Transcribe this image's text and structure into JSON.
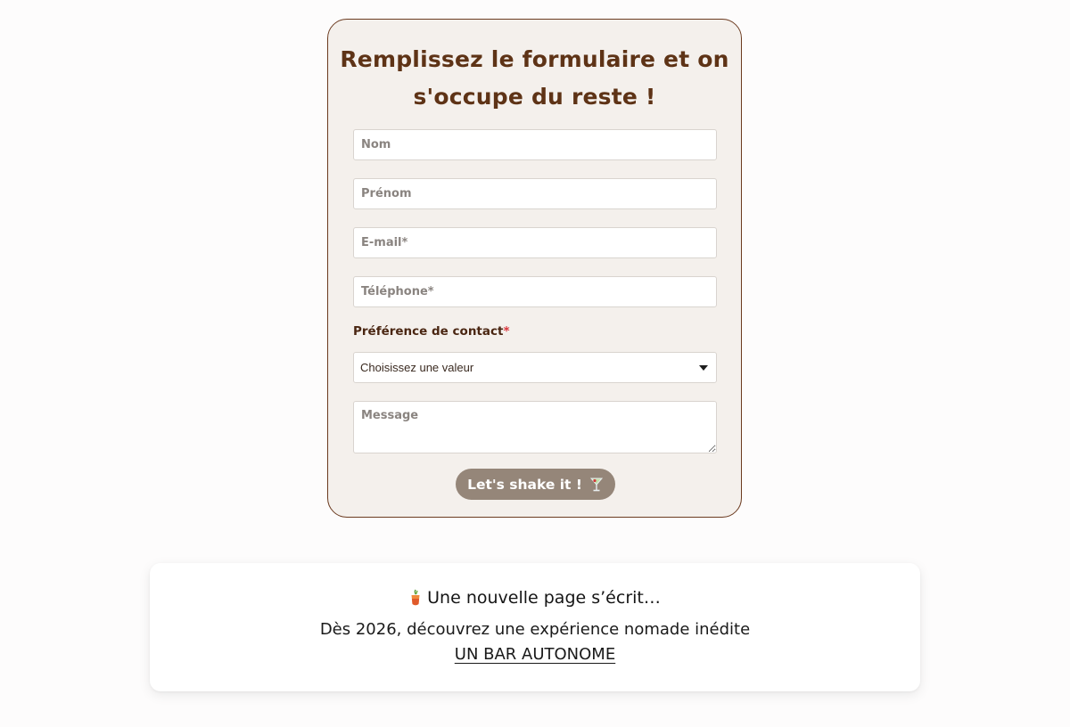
{
  "form": {
    "title_line1": "Remplissez le formulaire et on",
    "title_line2": "s'occupe du reste !",
    "fields": {
      "nom_placeholder": "Nom",
      "prenom_placeholder": "Prénom",
      "email_placeholder": "E-mail*",
      "telephone_placeholder": "Téléphone*",
      "message_placeholder": "Message"
    },
    "contact_preference": {
      "label": "Préférence de contact",
      "required_mark": "*",
      "selected_value": "Choisissez une valeur"
    },
    "submit_label": "Let's shake it !",
    "submit_icon": "cocktail-glass-icon"
  },
  "announcement": {
    "icon": "cocktail-drink-icon",
    "heading": "Une nouvelle page s’écrit…",
    "text": "Dès 2026, découvrez une expérience nomade inédite",
    "link_label": "UN BAR AUTONOME"
  },
  "colors": {
    "brand_brown": "#5e3316",
    "card_background": "#f4f0ec",
    "button_background": "#958679",
    "required_red": "#d9343b"
  }
}
